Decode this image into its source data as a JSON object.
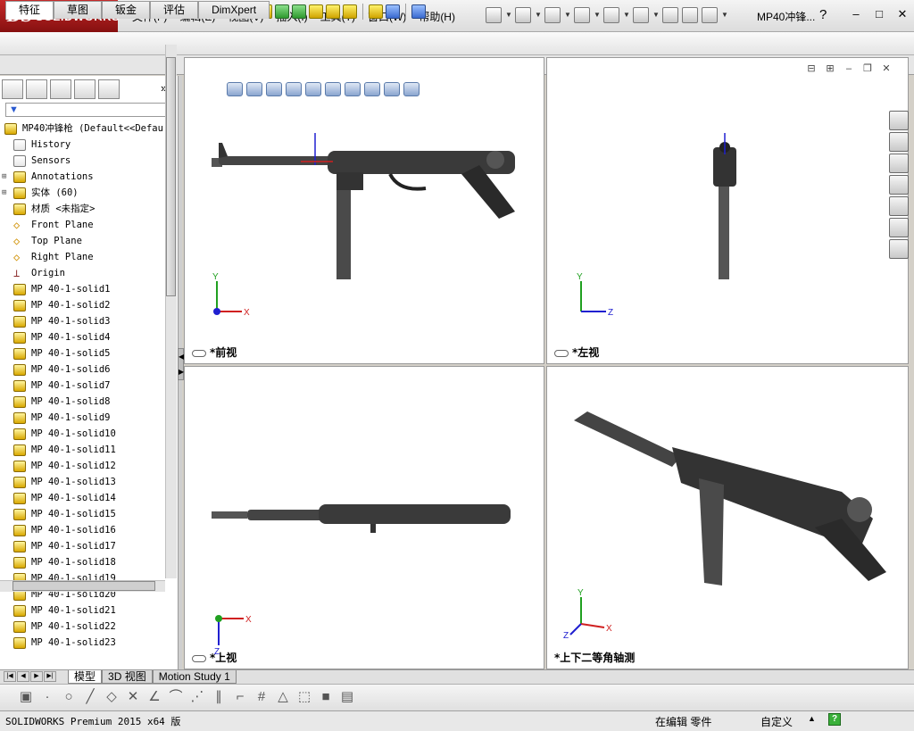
{
  "app": {
    "logo_ds": "DS",
    "logo_name": "SOLIDWORKS",
    "document_title": "MP40冲锋...",
    "help_glyph": "?",
    "window_controls": [
      "–",
      "□",
      "✕"
    ]
  },
  "menu": [
    "文件(F)",
    "编辑(E)",
    "视图(V)",
    "插入(I)",
    "工具(T)",
    "窗口(W)",
    "帮助(H)"
  ],
  "command_tabs": [
    {
      "label": "特征",
      "active": true
    },
    {
      "label": "草图",
      "active": false
    },
    {
      "label": "钣金",
      "active": false
    },
    {
      "label": "评估",
      "active": false
    },
    {
      "label": "DimXpert",
      "active": false
    }
  ],
  "tree": {
    "chevron": "»",
    "root": "MP40冲锋枪  (Default<<Defau",
    "items": [
      {
        "label": "History",
        "icon": "history-icon",
        "expandable": false
      },
      {
        "label": "Sensors",
        "icon": "sensors-icon",
        "expandable": false
      },
      {
        "label": "Annotations",
        "icon": "annotations-icon",
        "expandable": true
      },
      {
        "label": "实体 (60)",
        "icon": "solid-bodies-icon",
        "expandable": true
      },
      {
        "label": "材质 <未指定>",
        "icon": "material-icon",
        "expandable": false
      },
      {
        "label": "Front Plane",
        "icon": "plane-icon",
        "expandable": false
      },
      {
        "label": "Top Plane",
        "icon": "plane-icon",
        "expandable": false
      },
      {
        "label": "Right Plane",
        "icon": "plane-icon",
        "expandable": false
      },
      {
        "label": "Origin",
        "icon": "origin-icon",
        "expandable": false
      },
      {
        "label": "MP 40-1-solid1",
        "icon": "feature-icon",
        "expandable": false
      },
      {
        "label": "MP 40-1-solid2",
        "icon": "feature-icon",
        "expandable": false
      },
      {
        "label": "MP 40-1-solid3",
        "icon": "feature-icon",
        "expandable": false
      },
      {
        "label": "MP 40-1-solid4",
        "icon": "feature-icon",
        "expandable": false
      },
      {
        "label": "MP 40-1-solid5",
        "icon": "feature-icon",
        "expandable": false
      },
      {
        "label": "MP 40-1-solid6",
        "icon": "feature-icon",
        "expandable": false
      },
      {
        "label": "MP 40-1-solid7",
        "icon": "feature-icon",
        "expandable": false
      },
      {
        "label": "MP 40-1-solid8",
        "icon": "feature-icon",
        "expandable": false
      },
      {
        "label": "MP 40-1-solid9",
        "icon": "feature-icon",
        "expandable": false
      },
      {
        "label": "MP 40-1-solid10",
        "icon": "feature-icon",
        "expandable": false
      },
      {
        "label": "MP 40-1-solid11",
        "icon": "feature-icon",
        "expandable": false
      },
      {
        "label": "MP 40-1-solid12",
        "icon": "feature-icon",
        "expandable": false
      },
      {
        "label": "MP 40-1-solid13",
        "icon": "feature-icon",
        "expandable": false
      },
      {
        "label": "MP 40-1-solid14",
        "icon": "feature-icon",
        "expandable": false
      },
      {
        "label": "MP 40-1-solid15",
        "icon": "feature-icon",
        "expandable": false
      },
      {
        "label": "MP 40-1-solid16",
        "icon": "feature-icon",
        "expandable": false
      },
      {
        "label": "MP 40-1-solid17",
        "icon": "feature-icon",
        "expandable": false
      },
      {
        "label": "MP 40-1-solid18",
        "icon": "feature-icon",
        "expandable": false
      },
      {
        "label": "MP 40-1-solid19",
        "icon": "feature-icon",
        "expandable": false
      },
      {
        "label": "MP 40-1-solid20",
        "icon": "feature-icon",
        "expandable": false
      },
      {
        "label": "MP 40-1-solid21",
        "icon": "feature-icon",
        "expandable": false
      },
      {
        "label": "MP 40-1-solid22",
        "icon": "feature-icon",
        "expandable": false
      },
      {
        "label": "MP 40-1-solid23",
        "icon": "feature-icon",
        "expandable": false
      }
    ]
  },
  "viewports": {
    "front": {
      "label": "*前视",
      "axes": [
        "Y",
        "X"
      ]
    },
    "left": {
      "label": "*左视",
      "axes": [
        "Y",
        "Z"
      ]
    },
    "top": {
      "label": "*上视",
      "axes": [
        "X",
        "Z"
      ]
    },
    "iso": {
      "label": "*上下二等角轴测",
      "axes": [
        "Y",
        "X",
        "Z"
      ]
    }
  },
  "bottom_tabs": [
    {
      "label": "模型",
      "active": true
    },
    {
      "label": "3D 视图",
      "active": false
    },
    {
      "label": "Motion Study 1",
      "active": false
    }
  ],
  "status": {
    "product": "SOLIDWORKS Premium 2015 x64 版",
    "editing": "在编辑 零件",
    "units": "自定义",
    "arrow": "▲"
  },
  "colors": {
    "logo_red": "#b01e1e",
    "axis_x": "#d02020",
    "axis_y": "#20a020",
    "axis_z": "#2020d0",
    "model_dark": "#2a2a2a"
  }
}
